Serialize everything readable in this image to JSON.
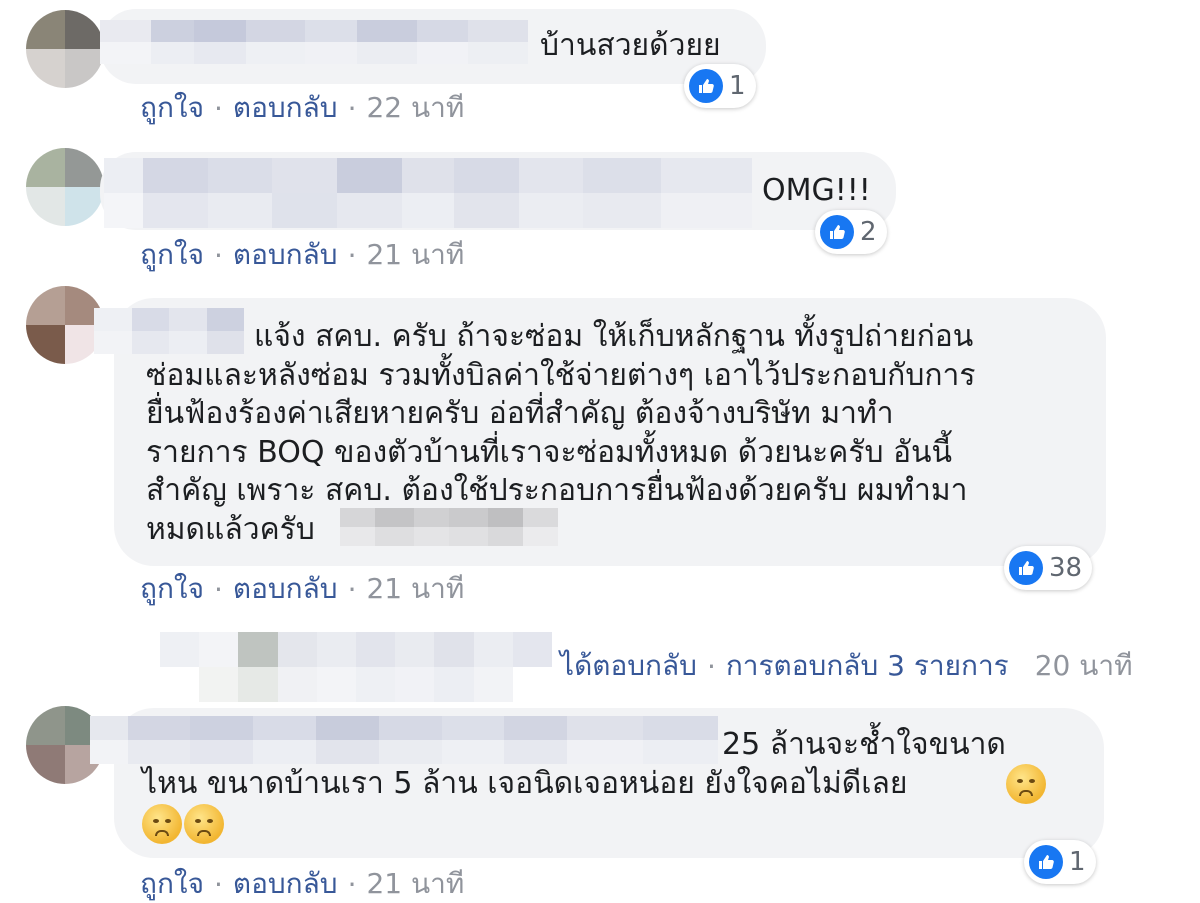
{
  "comments": [
    {
      "text_lines": [
        "บ้านสวยด้วยย"
      ],
      "reaction_count": "1",
      "actions": {
        "like": "ถูกใจ",
        "reply": "ตอบกลับ",
        "time": "22 นาที",
        "separator": "·"
      }
    },
    {
      "text_lines": [
        "OMG!!!"
      ],
      "reaction_count": "2",
      "actions": {
        "like": "ถูกใจ",
        "reply": "ตอบกลับ",
        "time": "21 นาที",
        "separator": "·"
      }
    },
    {
      "text_lines": [
        "แจ้ง สคบ. ครับ ถ้าจะซ่อม ให้เก็บหลักฐาน ทั้งรูปถ่ายก่อน",
        "ซ่อมและหลังซ่อม รวมทั้งบิลค่าใช้จ่ายต่างๆ เอาไว้ประกอบกับการ",
        "ยื่นฟ้องร้องค่าเสียหายครับ อ่อที่สำคัญ ต้องจ้างบริษัท มาทำ",
        "รายการ BOQ ของตัวบ้านที่เราจะซ่อมทั้งหมด ด้วยนะครับ อันนี้",
        "สำคัญ เพราะ สคบ. ต้องใช้ประกอบการยื่นฟ้องด้วยครับ ผมทำมา",
        "หมดแล้วครับ"
      ],
      "reaction_count": "38",
      "actions": {
        "like": "ถูกใจ",
        "reply": "ตอบกลับ",
        "time": "21 นาที",
        "separator": "·"
      },
      "replies": {
        "replied_label": "ได้ตอบกลับ",
        "count_label": "การตอบกลับ 3 รายการ",
        "time": "20 นาที",
        "separator": "·"
      }
    },
    {
      "text_lines": [
        "25 ล้านจะช้ำใจขนาด",
        "ไหน ขนาดบ้านเรา 5 ล้าน เจอนิดเจอหน่อย ยังใจคอไม่ดีเลย"
      ],
      "reaction_count": "1",
      "actions": {
        "like": "ถูกใจ",
        "reply": "ตอบกลับ",
        "time": "21 นาที",
        "separator": "·"
      }
    }
  ],
  "icons": {
    "reaction": "like-thumb-icon",
    "emoji": "worried-face-emoji"
  },
  "colors": {
    "bubble": "#f2f3f5",
    "link": "#385898",
    "muted": "#90949c",
    "like_blue": "#1877f2"
  }
}
